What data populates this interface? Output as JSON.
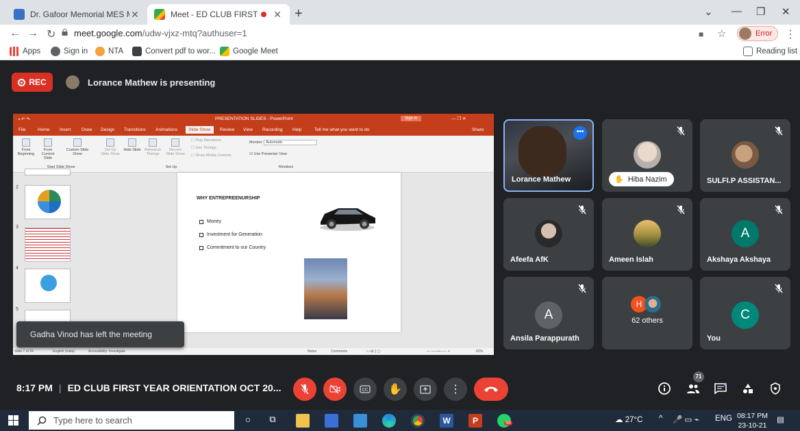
{
  "browser": {
    "tabs": [
      {
        "title": "Dr. Gafoor Memorial MES Mamp",
        "active": false
      },
      {
        "title": "Meet - ED CLUB FIRST YEAR",
        "active": true
      }
    ],
    "url_host": "meet.google.com",
    "url_path": "/udw-vjxz-mtq?authuser=1",
    "profile_label": "Error",
    "reading_list": "Reading list",
    "bookmarks": [
      "Apps",
      "Sign in",
      "NTA",
      "Convert pdf to wor...",
      "Google Meet"
    ]
  },
  "meet": {
    "rec_label": "REC",
    "presenting_text": "Lorance Mathew is presenting",
    "toast": "Gadha Vinod has left the meeting",
    "time": "8:17 PM",
    "meeting_title": "ED CLUB FIRST YEAR ORIENTATION OCT 20...",
    "participants_count": "71",
    "participants": [
      {
        "name": "Lorance Mathew"
      },
      {
        "name": "Hiba Nazim"
      },
      {
        "name": "SULFI.P ASSISTAN..."
      },
      {
        "name": "Afeefa AfK"
      },
      {
        "name": "Ameen Islah"
      },
      {
        "name": "Akshaya Akshaya",
        "letter": "A"
      },
      {
        "name": "Ansila Parappurath",
        "letter": "A"
      },
      {
        "name": "62 others",
        "letter": "H"
      },
      {
        "name": "You",
        "letter": "C"
      }
    ]
  },
  "powerpoint": {
    "window_title": "PRESENTATION SLIDES  -  PowerPoint",
    "sign_in": "Sign in",
    "tabs": [
      "File",
      "Home",
      "Insert",
      "Draw",
      "Design",
      "Transitions",
      "Animations",
      "Slide Show",
      "Review",
      "View",
      "Recording",
      "Help"
    ],
    "tell_me": "Tell me what you want to do",
    "share": "Share",
    "ribbon": {
      "from_beginning": "From Beginning",
      "from_current": "From Current Slide",
      "custom_show": "Custom Slide Show",
      "group_start": "Start Slide Show",
      "set_up": "Set Up Slide Show",
      "hide": "Hide Slide",
      "rehearse": "Rehearse Timings",
      "record": "Record Slide Show",
      "group_setup": "Set Up",
      "play_narrations": "Play Narrations",
      "use_timings": "Use Timings",
      "show_media": "Show Media Controls",
      "monitor_label": "Monitor:",
      "monitor_value": "Automatic",
      "presenter_view": "Use Presenter View",
      "group_monitors": "Monitors"
    },
    "thumb_numbers": [
      "2",
      "3",
      "4",
      "5"
    ],
    "slide": {
      "heading": "WHY  ENTREPREENURSHIP",
      "bullets": [
        "Money",
        "Investment for Generation",
        "Commitment to our Country"
      ]
    },
    "status": {
      "slide": "Slide 7 of 24",
      "language": "English (India)",
      "accessibility": "Accessibility: Investigate",
      "notes": "Notes",
      "comments": "Comments",
      "zoom": "62%"
    }
  },
  "taskbar": {
    "search_placeholder": "Type here to search",
    "weather": "27°C",
    "lang": "ENG",
    "time": "08:17 PM",
    "date": "23-10-21",
    "whatsapp_badge": "99"
  }
}
